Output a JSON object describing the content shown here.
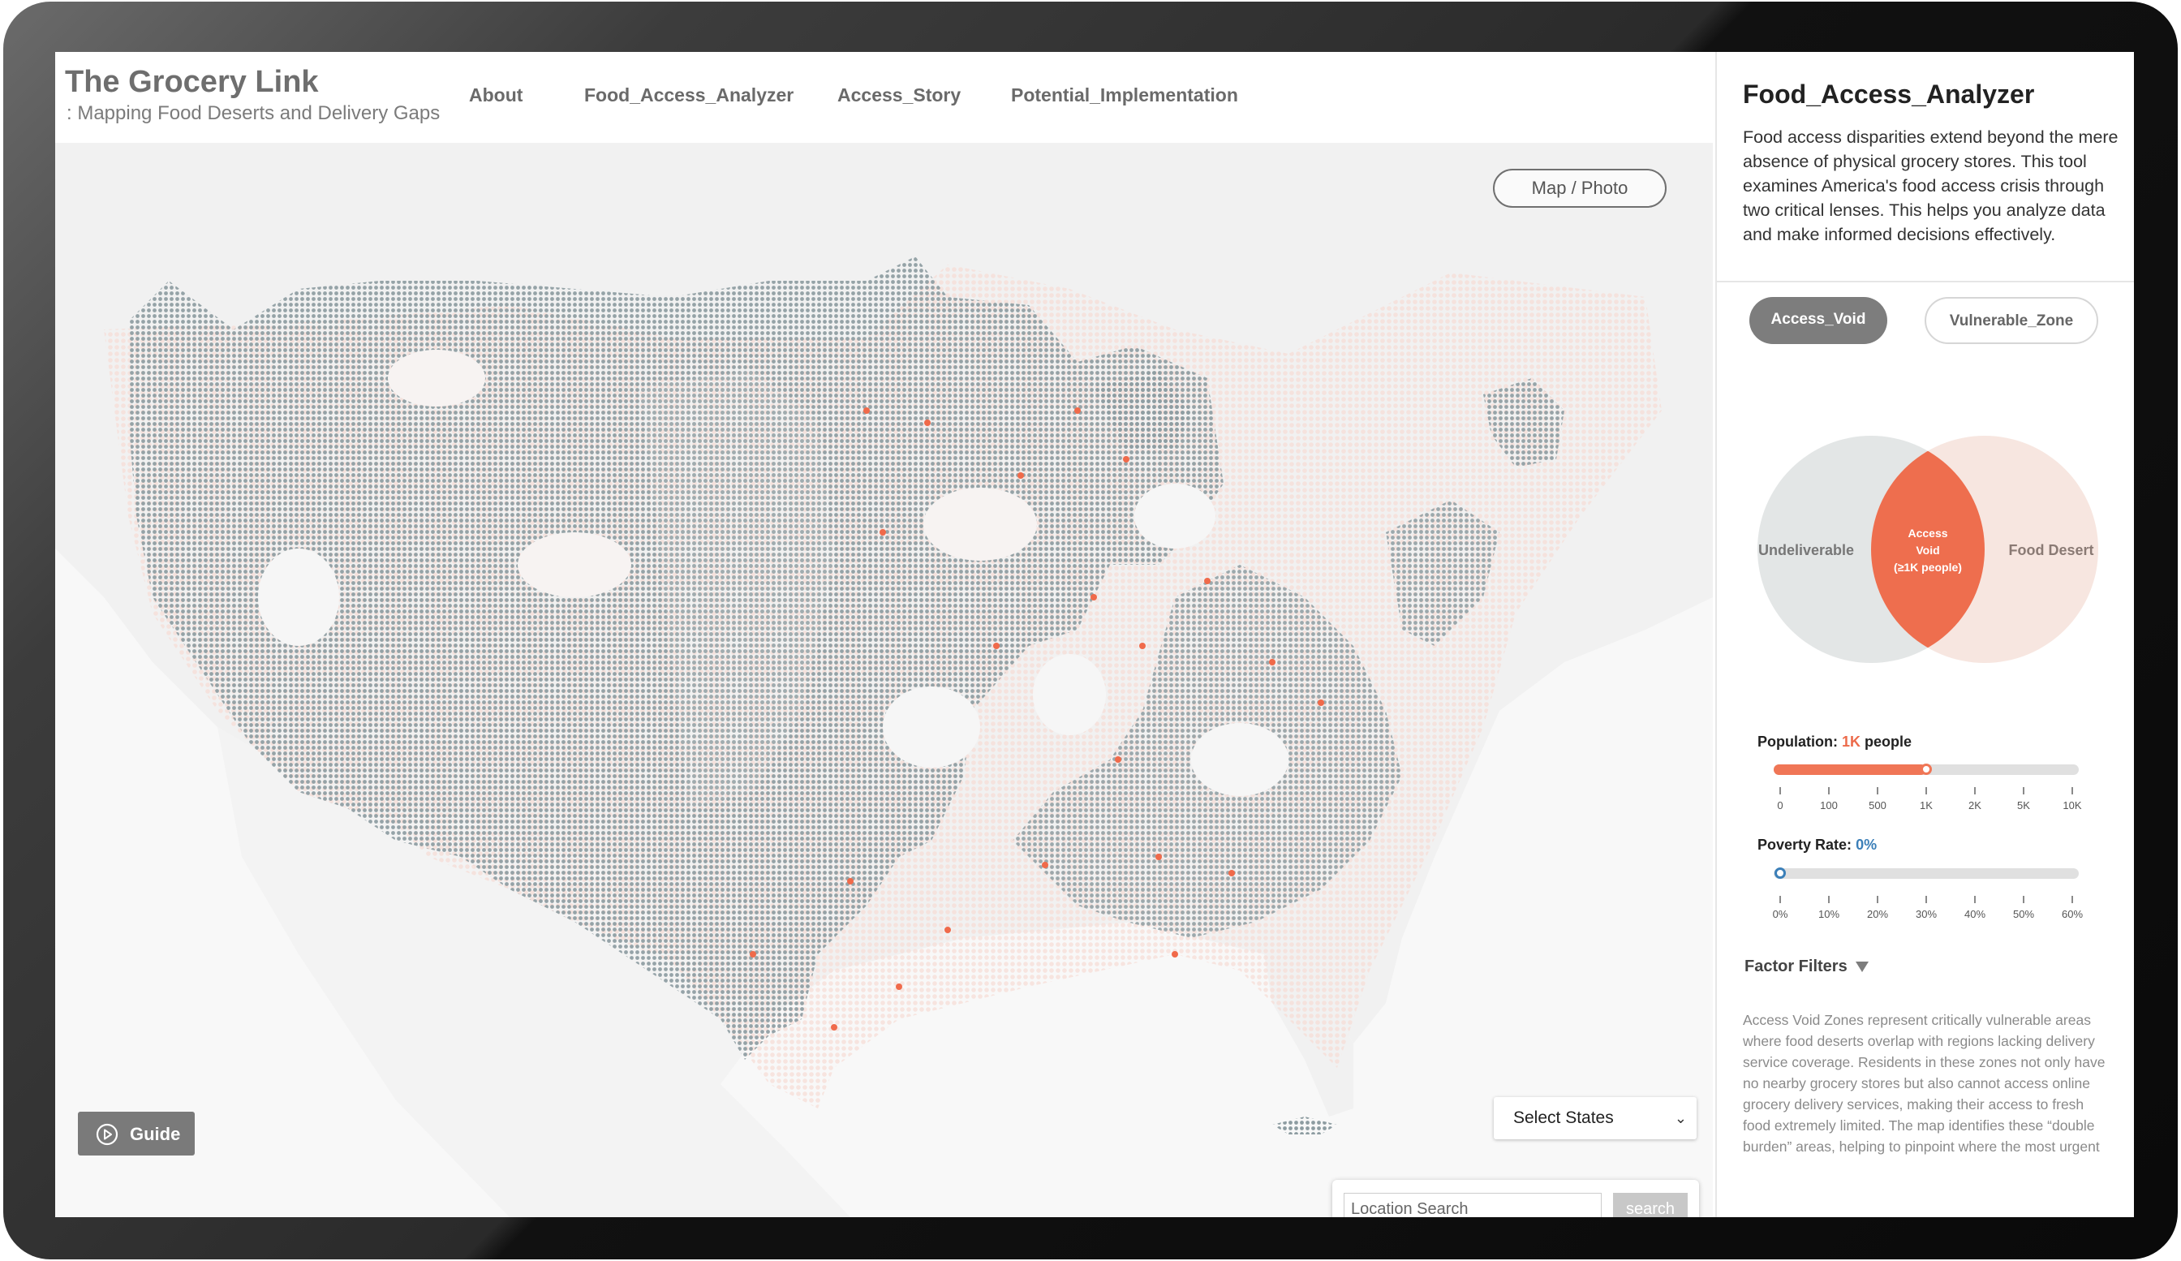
{
  "header": {
    "title": "The Grocery Link",
    "subtitle": ": Mapping Food Deserts and Delivery Gaps",
    "nav": [
      "About",
      "Food_Access_Analyzer",
      "Access_Story",
      "Potential_Implementation"
    ]
  },
  "map": {
    "toggle_label": "Map / Photo",
    "select_states": "Select States",
    "search_placeholder": "Location Search",
    "search_button": "search",
    "guide_label": "Guide",
    "colors": {
      "undeliverable": "#8e9ea3",
      "food_desert": "#f7dcd5",
      "access_void": "#f06a4a"
    }
  },
  "panel": {
    "title": "Food_Access_Analyzer",
    "description": "Food access disparities extend beyond the mere absence of physical grocery stores. This tool examines America's food access crisis through two critical lenses. This helps you analyze data and make informed decisions effectively.",
    "tabs": [
      "Access_Void",
      "Vulnerable_Zone"
    ],
    "venn": {
      "left": "Undeliverable",
      "right": "Food Desert",
      "center": [
        "Access",
        "Void",
        "(≥1K people)"
      ]
    },
    "population": {
      "label": "Population:",
      "value": "1K",
      "unit": "people",
      "fraction": 0.5,
      "ticks": [
        "0",
        "100",
        "500",
        "1K",
        "2K",
        "5K",
        "10K"
      ]
    },
    "poverty": {
      "label": "Poverty Rate:",
      "value": "0%",
      "fraction": 0,
      "ticks": [
        "0%",
        "10%",
        "20%",
        "30%",
        "40%",
        "50%",
        "60%"
      ]
    },
    "factor_filters": "Factor Filters",
    "note": "Access Void Zones represent critically vulnerable areas where food deserts overlap with regions lacking delivery service coverage. Residents in these zones not only have no nearby grocery stores but also cannot access online grocery delivery services, making their access to fresh food extremely limited. The map identifies these “double burden” areas, helping to pinpoint where the most urgent"
  }
}
